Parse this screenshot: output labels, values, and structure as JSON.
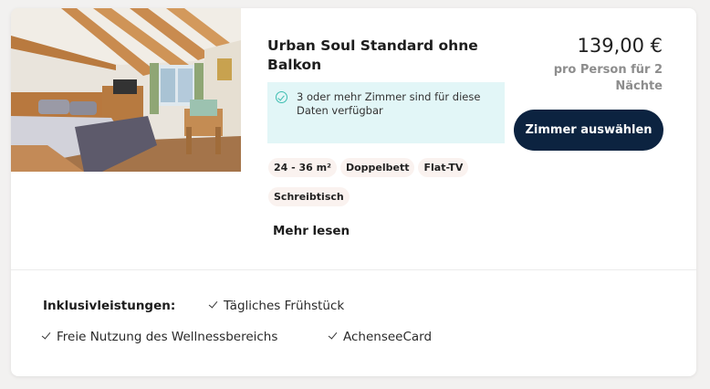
{
  "room": {
    "title": "Urban Soul Standard ohne Balkon",
    "availability": "3 oder mehr Zimmer sind für diese Daten verfügbar",
    "features": [
      "24 - 36 m²",
      "Doppelbett",
      "Flat-TV",
      "Schreibtisch"
    ],
    "more_label": "Mehr lesen"
  },
  "pricing": {
    "price": "139,00 €",
    "note": "pro Person für 2 Nächte",
    "select_label": "Zimmer auswählen"
  },
  "inclusions": {
    "label": "Inklusivleistungen:",
    "items": [
      "Tägliches Frühstück",
      "Freie Nutzung des Wellnessbereichs",
      "AchenseeCard"
    ]
  },
  "colors": {
    "button": "#0c2340",
    "availability_bg": "#e2f6f7",
    "check": "#3cbdb0",
    "chip_bg": "#faf2ef"
  },
  "icons": {
    "availability": "check-circle-icon",
    "inclusion": "checkmark-icon"
  }
}
